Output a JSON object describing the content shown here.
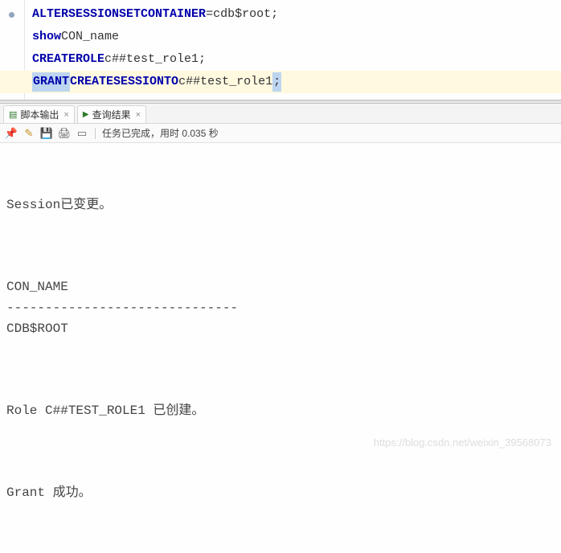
{
  "editor": {
    "lines": [
      {
        "tokens": [
          {
            "t": "ALTER",
            "c": "kw"
          },
          {
            "t": " ",
            "c": ""
          },
          {
            "t": "SESSION",
            "c": "kw"
          },
          {
            "t": " ",
            "c": ""
          },
          {
            "t": "SET",
            "c": "kw"
          },
          {
            "t": " ",
            "c": ""
          },
          {
            "t": "CONTAINER",
            "c": "kw"
          },
          {
            "t": "=cdb$root;",
            "c": "id"
          }
        ],
        "active": false,
        "dot": true
      },
      {
        "tokens": [
          {
            "t": "show",
            "c": "kw"
          },
          {
            "t": " CON_name",
            "c": "id"
          }
        ],
        "active": false,
        "dot": false
      },
      {
        "tokens": [
          {
            "t": "CREATE",
            "c": "kw"
          },
          {
            "t": " ",
            "c": ""
          },
          {
            "t": "ROLE",
            "c": "kw"
          },
          {
            "t": " c##test_role1;",
            "c": "id"
          }
        ],
        "active": false,
        "dot": false
      },
      {
        "tokens": [
          {
            "t": "GRANT",
            "c": "kw sel-start"
          },
          {
            "t": " ",
            "c": ""
          },
          {
            "t": "CREATE",
            "c": "kw"
          },
          {
            "t": " ",
            "c": ""
          },
          {
            "t": "SESSION",
            "c": "kw"
          },
          {
            "t": " ",
            "c": ""
          },
          {
            "t": "TO",
            "c": "kw"
          },
          {
            "t": " c##test_role1",
            "c": "id"
          },
          {
            "t": ";",
            "c": "punc sel-end"
          }
        ],
        "active": true,
        "dot": false
      }
    ]
  },
  "tabs": {
    "script_output": "脚本输出",
    "query_result": "查询结果"
  },
  "toolbar": {
    "status": "任务已完成，用时 0.035 秒"
  },
  "output": {
    "session_changed": "Session已变更。",
    "con_name_header": "CON_NAME",
    "con_name_rule": "------------------------------",
    "con_name_value": "CDB$ROOT",
    "role_created": "Role C##TEST_ROLE1 已创建。",
    "grant_ok": "Grant 成功。"
  },
  "watermark": "https://blog.csdn.net/weixin_39568073"
}
